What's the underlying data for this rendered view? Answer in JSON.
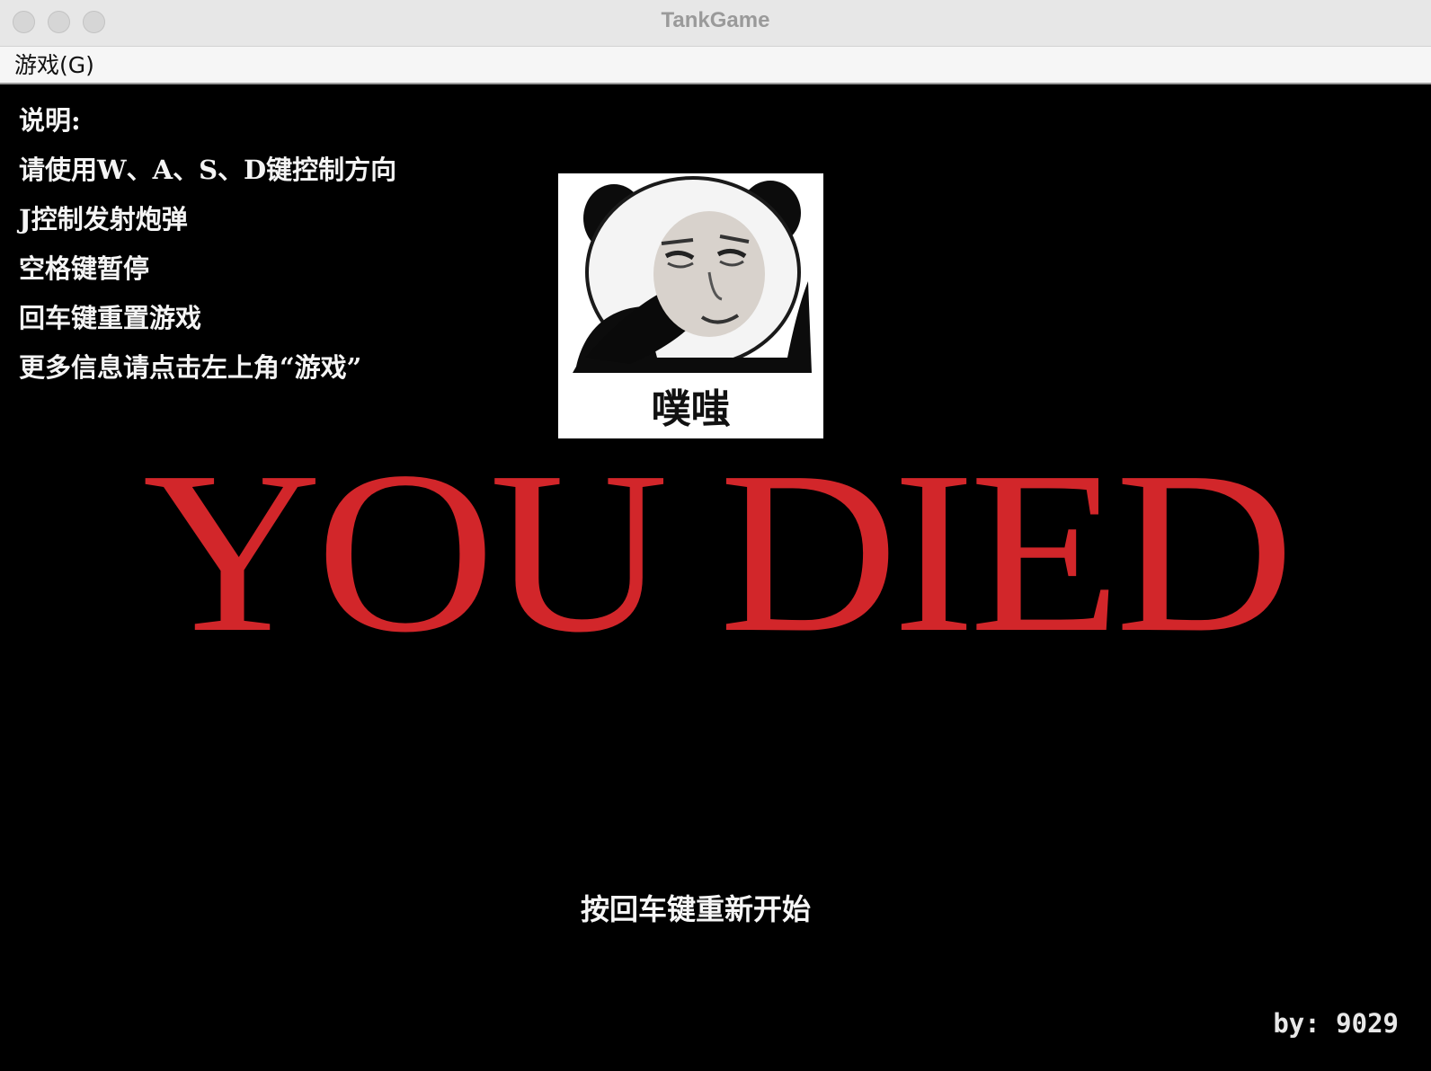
{
  "window": {
    "title": "TankGame",
    "controls": [
      "close",
      "minimize",
      "zoom"
    ]
  },
  "menubar": {
    "game_menu": "游戏(G)"
  },
  "instructions": [
    "说明:",
    "请使用W、A、S、D键控制方向",
    "J控制发射炮弹",
    "空格键暂停",
    "回车键重置游戏",
    "更多信息请点击左上角“游戏”"
  ],
  "meme": {
    "caption": "噗嗤",
    "icon": "panda-meme-icon"
  },
  "game_over": {
    "text": "YOU DIED",
    "color": "#d2262a"
  },
  "restart_hint": "按回车键重新开始",
  "byline": "by: 9029"
}
